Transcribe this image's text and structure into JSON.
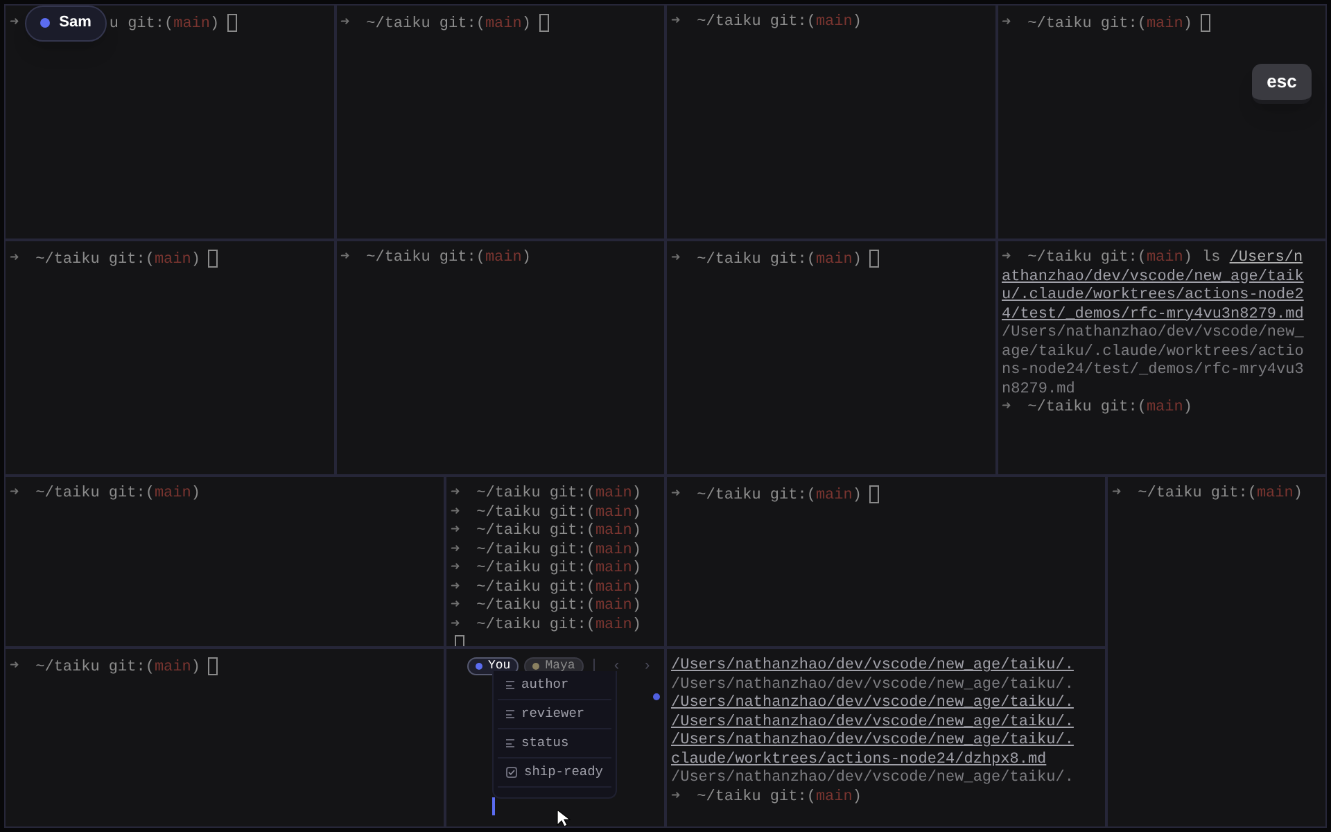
{
  "presence": {
    "name": "Sam",
    "color": "#5b6cf0"
  },
  "esc_key": "esc",
  "panes": [
    {
      "lines": [
        {
          "kind": "prompt",
          "arrow": "➜",
          "path": "u git:(",
          "branch": "main",
          "close": ")",
          "cursor": true
        }
      ]
    },
    {
      "lines": [
        {
          "kind": "prompt",
          "arrow": "➜",
          "path": "~/taiku git:(",
          "branch": "main",
          "close": ")",
          "cursor": true
        }
      ]
    },
    {
      "lines": [
        {
          "kind": "prompt",
          "arrow": "➜",
          "path": "~/taiku git:(",
          "branch": "main",
          "close": ")",
          "cursor": false
        }
      ]
    },
    {
      "lines": [
        {
          "kind": "prompt",
          "arrow": "➜",
          "path": "~/taiku git:(",
          "branch": "main",
          "close": ")",
          "cursor": true
        }
      ]
    },
    {
      "lines": [
        {
          "kind": "prompt",
          "arrow": "➜",
          "path": "~/taiku git:(",
          "branch": "main",
          "close": ")",
          "cursor": true
        }
      ]
    },
    {
      "lines": [
        {
          "kind": "prompt",
          "arrow": "➜",
          "path": "~/taiku git:(",
          "branch": "main",
          "close": ")",
          "cursor": false
        }
      ]
    },
    {
      "lines": [
        {
          "kind": "prompt",
          "arrow": "➜",
          "path": "~/taiku git:(",
          "branch": "main",
          "close": ")",
          "cursor": true
        }
      ]
    },
    {
      "lines": [
        {
          "kind": "prompt",
          "arrow": "➜",
          "path": "~/taiku git:(",
          "branch": "main",
          "close": ")",
          "command": "ls",
          "arg": "/Users/n",
          "cursor": false
        },
        {
          "kind": "output",
          "text": "athanzhao/dev/vscode/new_age/taik",
          "link": true
        },
        {
          "kind": "output",
          "text": "u/.claude/worktrees/actions-node2",
          "link": true
        },
        {
          "kind": "output",
          "text": "4/test/_demos/rfc-mry4vu3n8279.md",
          "link": true
        },
        {
          "kind": "output",
          "text": "/Users/nathanzhao/dev/vscode/new_",
          "link": false
        },
        {
          "kind": "output",
          "text": "age/taiku/.claude/worktrees/actio",
          "link": false
        },
        {
          "kind": "output",
          "text": "ns-node24/test/_demos/rfc-mry4vu3",
          "link": false
        },
        {
          "kind": "output",
          "text": "n8279.md",
          "link": false
        },
        {
          "kind": "prompt",
          "arrow": "➜",
          "path": "~/taiku git:(",
          "branch": "main",
          "close": ")",
          "cursor": false
        }
      ]
    },
    {
      "lines": [
        {
          "kind": "prompt",
          "arrow": "➜",
          "path": "~/taiku git:(",
          "branch": "main",
          "close": ")",
          "cursor": false
        }
      ]
    },
    {
      "lines": [
        {
          "kind": "prompt",
          "arrow": "➜",
          "path": "~/taiku git:(",
          "branch": "main",
          "close": ")",
          "cursor": false
        },
        {
          "kind": "prompt",
          "arrow": "➜",
          "path": "~/taiku git:(",
          "branch": "main",
          "close": ")",
          "cursor": false
        },
        {
          "kind": "prompt",
          "arrow": "➜",
          "path": "~/taiku git:(",
          "branch": "main",
          "close": ")",
          "cursor": false
        },
        {
          "kind": "prompt",
          "arrow": "➜",
          "path": "~/taiku git:(",
          "branch": "main",
          "close": ")",
          "cursor": false
        },
        {
          "kind": "prompt",
          "arrow": "➜",
          "path": "~/taiku git:(",
          "branch": "main",
          "close": ")",
          "cursor": false
        },
        {
          "kind": "prompt",
          "arrow": "➜",
          "path": "~/taiku git:(",
          "branch": "main",
          "close": ")",
          "cursor": false
        },
        {
          "kind": "prompt",
          "arrow": "➜",
          "path": "~/taiku git:(",
          "branch": "main",
          "close": ")",
          "cursor": false
        },
        {
          "kind": "prompt",
          "arrow": "➜",
          "path": "~/taiku git:(",
          "branch": "main",
          "close": ")",
          "cursor": false
        },
        {
          "kind": "cursor"
        }
      ]
    },
    {
      "lines": [
        {
          "kind": "prompt",
          "arrow": "➜",
          "path": "~/taiku git:(",
          "branch": "main",
          "close": ")",
          "cursor": true
        }
      ]
    },
    {
      "lines": [
        {
          "kind": "prompt",
          "arrow": "➜",
          "path": "~/taiku git:(",
          "branch": "main",
          "close": ")",
          "cursor": false
        }
      ]
    },
    {
      "lines": [
        {
          "kind": "prompt",
          "arrow": "➜",
          "path": "~/taiku git:(",
          "branch": "main",
          "close": ")",
          "cursor": true
        }
      ]
    },
    {
      "popup": {
        "chips": [
          {
            "label": "You",
            "color": "#5b6cf0",
            "selected": true
          },
          {
            "label": "Maya",
            "color": "#8a8060",
            "selected": false
          }
        ],
        "nav": [
          "‹",
          "›"
        ],
        "menu": [
          {
            "kind": "field",
            "label": "author"
          },
          {
            "kind": "field",
            "label": "reviewer"
          },
          {
            "kind": "field",
            "label": "status"
          },
          {
            "kind": "checkbox",
            "label": "ship-ready",
            "checked": true
          }
        ]
      }
    },
    {
      "lines": [
        {
          "kind": "output",
          "text": "/Users/nathanzhao/dev/vscode/new_age/taiku/.",
          "link": true
        },
        {
          "kind": "output",
          "text": "/Users/nathanzhao/dev/vscode/new_age/taiku/.",
          "link": false
        },
        {
          "kind": "output",
          "text": "/Users/nathanzhao/dev/vscode/new_age/taiku/.",
          "link": true
        },
        {
          "kind": "output",
          "text": "/Users/nathanzhao/dev/vscode/new_age/taiku/.",
          "link": true
        },
        {
          "kind": "output",
          "text": "/Users/nathanzhao/dev/vscode/new_age/taiku/.",
          "link": true
        },
        {
          "kind": "output",
          "text": "claude/worktrees/actions-node24/dzhpx8.md",
          "link": true
        },
        {
          "kind": "output",
          "text": "/Users/nathanzhao/dev/vscode/new_age/taiku/.",
          "link": false
        },
        {
          "kind": "prompt",
          "arrow": "➜",
          "path": "~/taiku git:(",
          "branch": "main",
          "close": ")",
          "cursor": false
        }
      ]
    }
  ]
}
